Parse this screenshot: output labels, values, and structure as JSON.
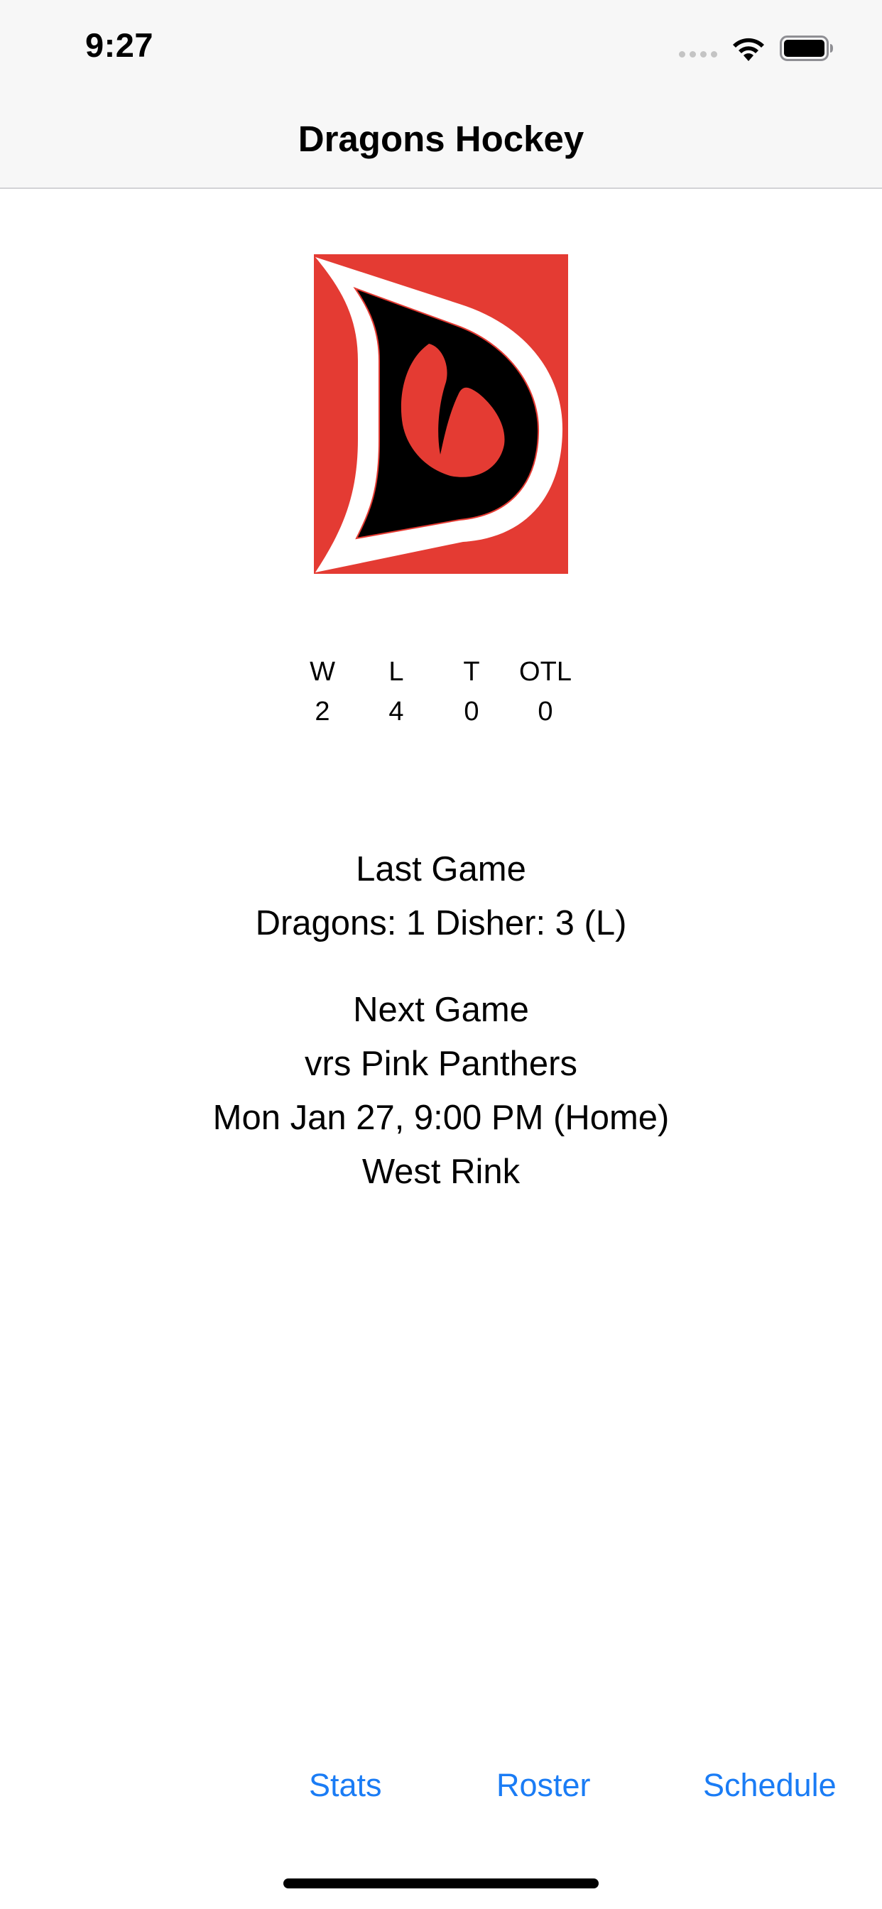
{
  "status_bar": {
    "time": "9:27"
  },
  "nav": {
    "title": "Dragons Hockey"
  },
  "colors": {
    "accent": "#1a7cf5",
    "logo_red": "#e43b33"
  },
  "icons": {
    "wifi": "wifi-icon",
    "battery": "battery-icon",
    "signal": "signal-icon",
    "logo": "dragons-logo"
  },
  "record": {
    "columns": [
      {
        "label": "W",
        "value": "2"
      },
      {
        "label": "L",
        "value": "4"
      },
      {
        "label": "T",
        "value": "0"
      },
      {
        "label": "OTL",
        "value": "0"
      }
    ]
  },
  "last_game": {
    "heading": "Last Game",
    "result": "Dragons: 1 Disher: 3 (L)"
  },
  "next_game": {
    "heading": "Next Game",
    "opponent": "vrs Pink Panthers",
    "datetime": "Mon Jan 27, 9:00 PM (Home)",
    "location": "West Rink"
  },
  "tabs": {
    "stats": "Stats",
    "roster": "Roster",
    "schedule": "Schedule"
  }
}
